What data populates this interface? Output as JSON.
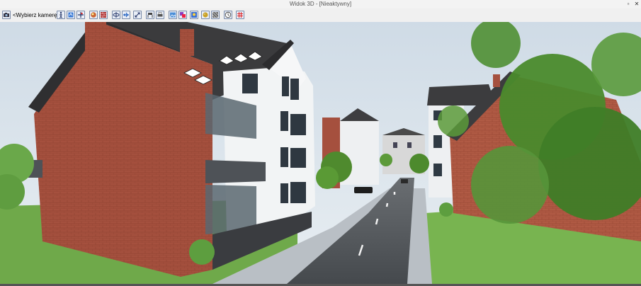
{
  "window": {
    "title": "Widok 3D - [Nieaktywny]",
    "restore_label": "▫",
    "close_label": "✕"
  },
  "toolbar": {
    "camera_select_value": "<Wybierz kamerę>",
    "buttons": [
      {
        "name": "camera-icon"
      },
      {
        "name": "walk-person-icon"
      },
      {
        "name": "rotate-view-icon"
      },
      {
        "name": "pan-view-icon"
      },
      {
        "name": "render-sphere-icon"
      },
      {
        "name": "wall-view-icon"
      },
      {
        "name": "orbit-icon"
      },
      {
        "name": "fly-icon"
      },
      {
        "name": "zoom-extents-icon"
      },
      {
        "name": "furniture-icon"
      },
      {
        "name": "printer-icon"
      },
      {
        "name": "image-export-icon"
      },
      {
        "name": "layers-icon"
      },
      {
        "name": "light-settings-icon"
      },
      {
        "name": "material-icon"
      },
      {
        "name": "texture-icon"
      },
      {
        "name": "clock-icon"
      },
      {
        "name": "grid-icon"
      }
    ]
  },
  "colors": {
    "sky": "#d9e6ee",
    "brick": "#a5503e",
    "roof": "#3c3c3e",
    "road": "#4e5256",
    "sidewalk": "#b6bcc2",
    "grass": "#6fb04a",
    "tree": "#4f8a2e"
  }
}
